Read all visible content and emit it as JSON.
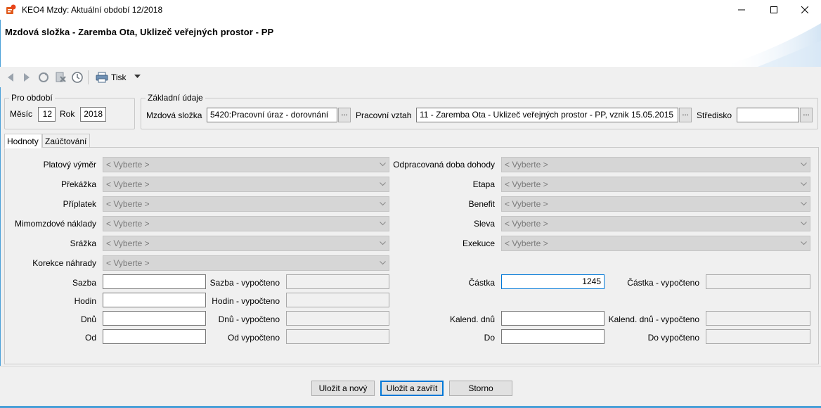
{
  "window": {
    "title": "KEO4 Mzdy: Aktuální období 12/2018"
  },
  "header": {
    "title": "Mzdová složka - Zaremba Ota, Uklizeč veřejných prostor - PP"
  },
  "toolbar": {
    "print_label": "Tisk",
    "icons": [
      "back-icon",
      "forward-icon",
      "refresh-icon",
      "delete-icon",
      "history-icon",
      "printer-icon",
      "chevron-down-icon"
    ]
  },
  "period": {
    "legend": "Pro období",
    "month_label": "Měsíc",
    "month_value": "12",
    "year_label": "Rok",
    "year_value": "2018"
  },
  "basic": {
    "legend": "Základní údaje",
    "component_label": "Mzdová složka",
    "component_value": "5420:Pracovní úraz - dorovnání",
    "relation_label": "Pracovní vztah",
    "relation_value": "11 - Zaremba Ota - Uklizeč veřejných prostor - PP, vznik 15.05.2015",
    "center_label": "Středisko",
    "center_value": "",
    "ellipsis": "..."
  },
  "tabs": [
    {
      "label": "Hodnoty",
      "active": true
    },
    {
      "label": "Zaúčtování",
      "active": false
    }
  ],
  "combo_placeholder": "< Vyberte >",
  "left_combos": [
    {
      "label": "Platový výměr"
    },
    {
      "label": "Překážka"
    },
    {
      "label": "Příplatek"
    },
    {
      "label": "Mimomzdové náklady"
    },
    {
      "label": "Srážka"
    },
    {
      "label": "Korekce náhrady"
    }
  ],
  "right_combos": [
    {
      "label": "Odpracovaná doba dohody"
    },
    {
      "label": "Etapa"
    },
    {
      "label": "Benefit"
    },
    {
      "label": "Sleva"
    },
    {
      "label": "Exekuce"
    }
  ],
  "left_fields": [
    {
      "label": "Sazba",
      "value": "",
      "calc_label": "Sazba - vypočteno",
      "calc_value": ""
    },
    {
      "label": "Hodin",
      "value": "",
      "calc_label": "Hodin - vypočteno",
      "calc_value": ""
    },
    {
      "label": "Dnů",
      "value": "",
      "calc_label": "Dnů - vypočteno",
      "calc_value": ""
    },
    {
      "label": "Od",
      "value": "",
      "calc_label": "Od vypočteno",
      "calc_value": ""
    }
  ],
  "right_fields": [
    {
      "label": "Částka",
      "value": "1245",
      "calc_label": "Částka - vypočteno",
      "calc_value": ""
    },
    {
      "label": "Kalend. dnů",
      "value": "",
      "calc_label": "Kalend. dnů - vypočteno",
      "calc_value": ""
    },
    {
      "label": "Do",
      "value": "",
      "calc_label": "Do vypočteno",
      "calc_value": ""
    }
  ],
  "buttons": {
    "save_new": "Uložit a nový",
    "save_close": "Uložit a zavřít",
    "cancel": "Storno"
  },
  "colors": {
    "accent": "#0078d7",
    "disabled_combo": "#d6d6d6"
  }
}
